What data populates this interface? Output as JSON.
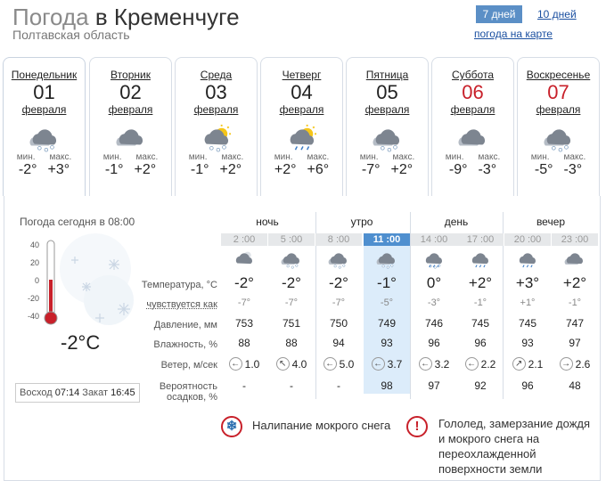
{
  "header": {
    "title_prefix": "Погода",
    "title_city": "в Кременчуге",
    "region": "Полтавская область",
    "range_active": "7 дней",
    "range_other": "10 дней",
    "map_link": "погода на карте"
  },
  "labels": {
    "min": "мин.",
    "max": "макс."
  },
  "days": [
    {
      "name": "Понедельник",
      "num": "01",
      "month": "февраля",
      "min": "-2°",
      "max": "+3°",
      "icon": "snow-cloud-icon",
      "weekend": false
    },
    {
      "name": "Вторник",
      "num": "02",
      "month": "февраля",
      "min": "-1°",
      "max": "+2°",
      "icon": "overcast-icon",
      "weekend": false
    },
    {
      "name": "Среда",
      "num": "03",
      "month": "февраля",
      "min": "-1°",
      "max": "+2°",
      "icon": "sun-cloud-snow-icon",
      "weekend": false
    },
    {
      "name": "Четверг",
      "num": "04",
      "month": "февраля",
      "min": "+2°",
      "max": "+6°",
      "icon": "sun-cloud-rain-icon",
      "weekend": false
    },
    {
      "name": "Пятница",
      "num": "05",
      "month": "февраля",
      "min": "-7°",
      "max": "+2°",
      "icon": "snow-cloud-icon",
      "weekend": false
    },
    {
      "name": "Суббота",
      "num": "06",
      "month": "февраля",
      "min": "-9°",
      "max": "-3°",
      "icon": "overcast-icon",
      "weekend": true
    },
    {
      "name": "Воскресенье",
      "num": "07",
      "month": "февраля",
      "min": "-5°",
      "max": "-3°",
      "icon": "snow-cloud-icon",
      "weekend": true
    }
  ],
  "today": {
    "label": "Погода сегодня в 08:00",
    "temp": "-2°C",
    "thermo_scale": [
      "40",
      "20",
      "0",
      "-20",
      "-40"
    ],
    "sunrise_label": "Восход",
    "sunrise": "07:14",
    "sunset_label": "Закат",
    "sunset": "16:45"
  },
  "periods": [
    "ночь",
    "утро",
    "день",
    "вечер"
  ],
  "hours": [
    "2 :00",
    "5 :00",
    "8 :00",
    "11 :00",
    "14 :00",
    "17 :00",
    "20 :00",
    "23 :00"
  ],
  "current_hour_index": 3,
  "row_labels": {
    "temp": "Температура, °C",
    "feel": "чувствуется как",
    "pressure": "Давление, мм",
    "humidity": "Влажность, %",
    "wind": "Ветер, м/сек",
    "precip_line1": "Вероятность",
    "precip_line2": "осадков, %"
  },
  "hourly": [
    {
      "temp": "-2°",
      "feel": "-7°",
      "pressure": "753",
      "humidity": "88",
      "wind_dir": "←",
      "wind": "1.0",
      "precip": "-",
      "icon": "cloudy-night-icon"
    },
    {
      "temp": "-2°",
      "feel": "-7°",
      "pressure": "751",
      "humidity": "88",
      "wind_dir": "↖",
      "wind": "4.0",
      "precip": "-",
      "icon": "snow-cloud-icon"
    },
    {
      "temp": "-2°",
      "feel": "-7°",
      "pressure": "750",
      "humidity": "94",
      "wind_dir": "←",
      "wind": "5.0",
      "precip": "-",
      "icon": "snow-cloud-icon"
    },
    {
      "temp": "-1°",
      "feel": "-5°",
      "pressure": "749",
      "humidity": "93",
      "wind_dir": "←",
      "wind": "3.7",
      "precip": "98",
      "icon": "snow-cloud-icon"
    },
    {
      "temp": "0°",
      "feel": "-3°",
      "pressure": "746",
      "humidity": "96",
      "wind_dir": "←",
      "wind": "3.2",
      "precip": "97",
      "icon": "snow-rain-icon"
    },
    {
      "temp": "+2°",
      "feel": "-1°",
      "pressure": "745",
      "humidity": "96",
      "wind_dir": "←",
      "wind": "2.2",
      "precip": "92",
      "icon": "rain-cloud-icon"
    },
    {
      "temp": "+3°",
      "feel": "+1°",
      "pressure": "745",
      "humidity": "93",
      "wind_dir": "↗",
      "wind": "2.1",
      "precip": "96",
      "icon": "rain-cloud-icon"
    },
    {
      "temp": "+2°",
      "feel": "-1°",
      "pressure": "747",
      "humidity": "97",
      "wind_dir": "→",
      "wind": "2.6",
      "precip": "48",
      "icon": "overcast-icon"
    }
  ],
  "warnings": [
    {
      "text": "Налипание мокрого снега",
      "icon": "snowflake-warning-icon"
    },
    {
      "text": "Гололед, замерзание дождя и мокрого снега на переохлажденной поверхности земли",
      "icon": "exclamation-warning-icon"
    }
  ],
  "colors": {
    "accent": "#4f8fcf",
    "weekend": "#c8202a",
    "current_column": "#dcecfa"
  }
}
